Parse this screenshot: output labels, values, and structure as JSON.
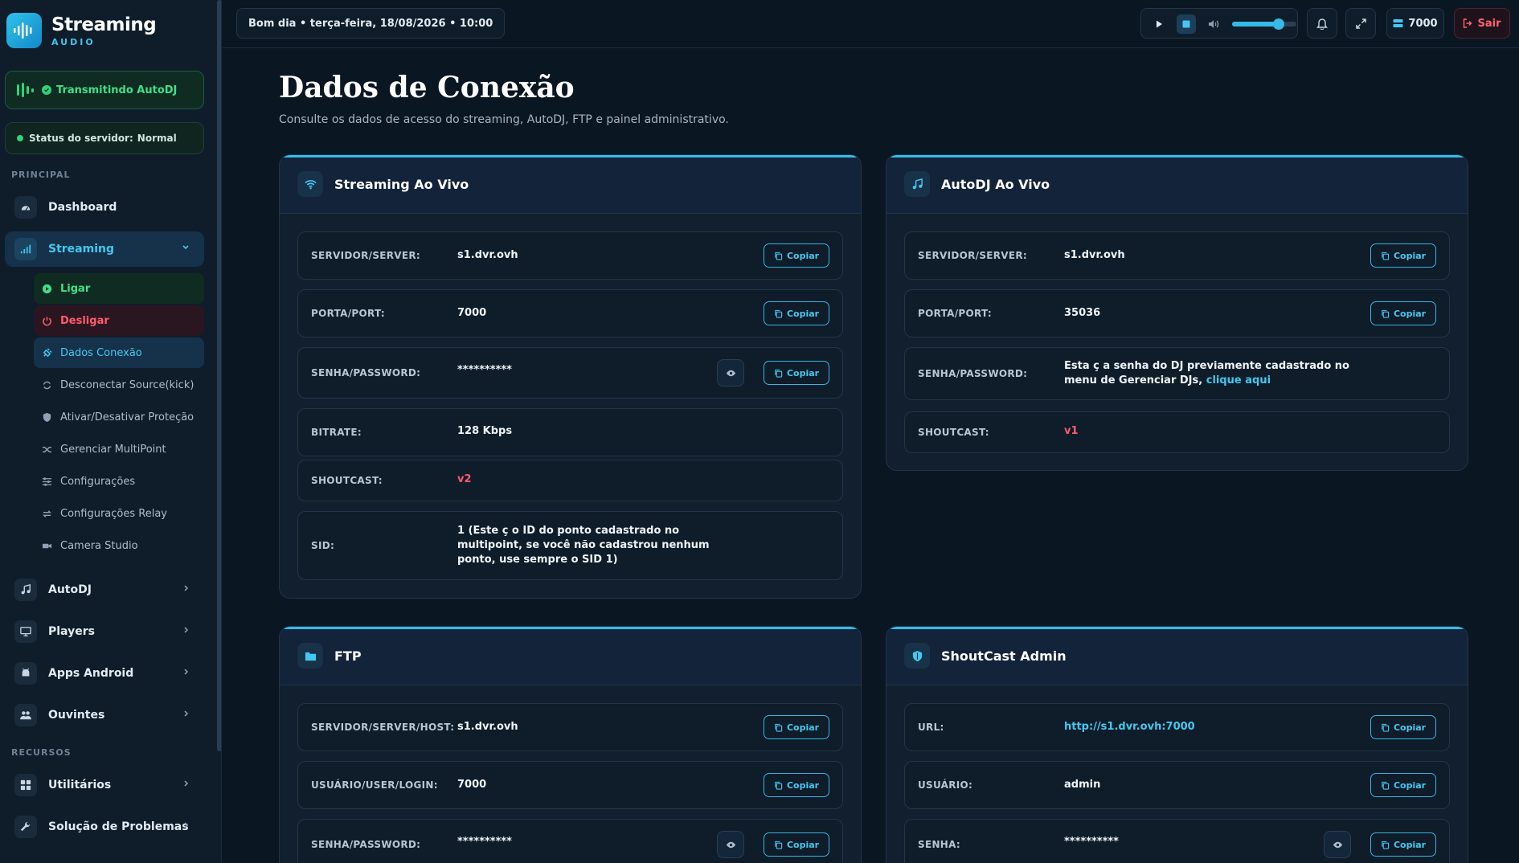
{
  "brand": {
    "title": "Streaming",
    "subtitle": "AUDIO"
  },
  "live": {
    "label": "Transmitindo AutoDJ"
  },
  "server_status": {
    "label": "Status do servidor:",
    "value": "Normal"
  },
  "sidebar": {
    "sections": {
      "principal": "PRINCIPAL",
      "recursos": "RECURSOS"
    },
    "items": {
      "dashboard": "Dashboard",
      "streaming": "Streaming",
      "autodj": "AutoDJ",
      "players": "Players",
      "apps_android": "Apps Android",
      "ouvintes": "Ouvintes",
      "utilitarios": "Utilitários",
      "solucao": "Solução de Problemas"
    },
    "streaming_sub": {
      "ligar": "Ligar",
      "desligar": "Desligar",
      "dados": "Dados Conexão",
      "desconectar": "Desconectar Source(kick)",
      "protecao": "Ativar/Desativar Proteção",
      "multipoint": "Gerenciar MultiPoint",
      "config": "Configurações",
      "relay": "Configurações Relay",
      "camera": "Camera Studio"
    }
  },
  "topbar": {
    "greeting": "Bom dia • terça-feira, 18/08/2026 • 10:00",
    "volume": 0.72,
    "port": "7000",
    "logout": "Sair"
  },
  "page": {
    "title": "Dados de Conexão",
    "subtitle": "Consulte os dados de acesso do streaming, AutoDJ, FTP e painel administrativo."
  },
  "copy_label": "Copiar",
  "streaming_card": {
    "title": "Streaming Ao Vivo",
    "server_label": "SERVIDOR/SERVER:",
    "server_value": "s1.dvr.ovh",
    "port_label": "PORTA/PORT:",
    "port_value": "7000",
    "pass_label": "SENHA/PASSWORD:",
    "pass_value": "**********",
    "bitrate_label": "BITRATE:",
    "bitrate_value": "128 Kbps",
    "shoutcast_label": "SHOUTCAST:",
    "shoutcast_value": "v2",
    "sid_label": "SID:",
    "sid_value": "1 (Este ç o ID do ponto cadastrado no multipoint, se você não cadastrou nenhum ponto, use sempre o SID 1)"
  },
  "autodj_card": {
    "title": "AutoDJ Ao Vivo",
    "server_label": "SERVIDOR/SERVER:",
    "server_value": "s1.dvr.ovh",
    "port_label": "PORTA/PORT:",
    "port_value": "35036",
    "pass_label": "SENHA/PASSWORD:",
    "pass_value": "Esta ç a senha do DJ previamente cadastrado no menu de Gerenciar DJs,",
    "pass_link": "clique aqui",
    "shoutcast_label": "SHOUTCAST:",
    "shoutcast_value": "v1"
  },
  "ftp_card": {
    "title": "FTP",
    "server_label": "SERVIDOR/SERVER/HOST:",
    "server_value": "s1.dvr.ovh",
    "user_label": "USUÁRIO/USER/LOGIN:",
    "user_value": "7000",
    "pass_label": "SENHA/PASSWORD:",
    "pass_value": "**********"
  },
  "admin_card": {
    "title": "ShoutCast Admin",
    "url_label": "URL:",
    "url_value": "http://s1.dvr.ovh:7000",
    "user_label": "USUÁRIO:",
    "user_value": "admin",
    "pass_label": "SENHA:",
    "pass_value": "**********"
  }
}
